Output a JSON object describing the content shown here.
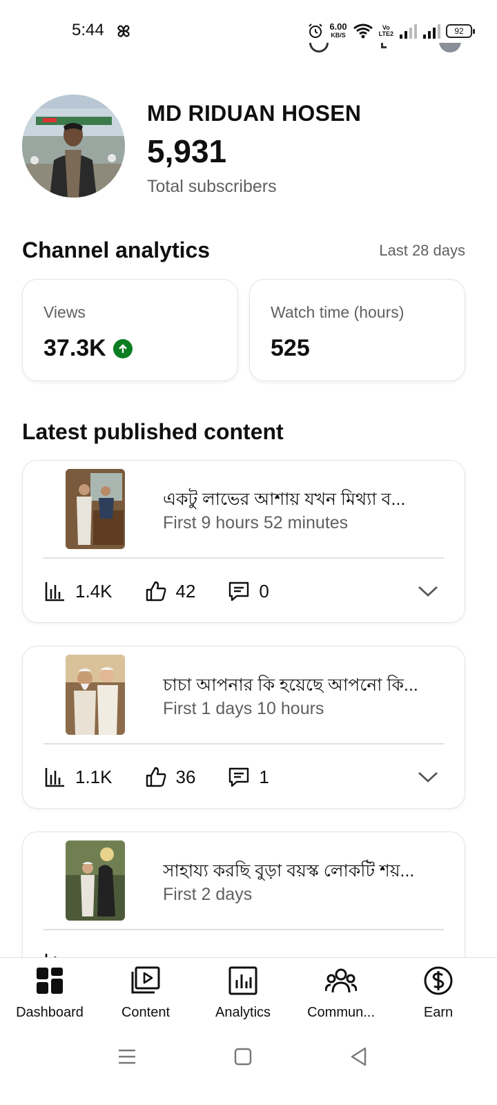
{
  "status_bar": {
    "time": "5:44",
    "speed_value": "6.00",
    "speed_unit": "KB/S",
    "volte_top": "Vo",
    "volte_bottom": "LTE2",
    "battery": "92"
  },
  "channel": {
    "name": "MD RIDUAN HOSEN",
    "subscribers": "5,931",
    "subscribers_label": "Total subscribers"
  },
  "analytics": {
    "title": "Channel analytics",
    "period": "Last 28 days",
    "views_label": "Views",
    "views_value": "37.3K",
    "watch_label": "Watch time (hours)",
    "watch_value": "525",
    "trend_color": "#0b7d22"
  },
  "latest": {
    "title": "Latest published content",
    "items": [
      {
        "title": "একটু লাভের আশায় যখন মিথ্যা ব...",
        "subtitle": "First 9 hours 52 minutes",
        "views": "1.4K",
        "likes": "42",
        "comments": "0"
      },
      {
        "title": "চাচা আপনার কি হয়েছে আপনো কি...",
        "subtitle": "First 1 days 10 hours",
        "views": "1.1K",
        "likes": "36",
        "comments": "1"
      },
      {
        "title": "সাহায্য করছি বুড়া বয়স্ক লোকটি শয়...",
        "subtitle": "First 2 days",
        "views": "",
        "likes": "",
        "comments": ""
      }
    ]
  },
  "nav": {
    "dashboard": "Dashboard",
    "content": "Content",
    "analytics": "Analytics",
    "community": "Commun...",
    "earn": "Earn"
  }
}
